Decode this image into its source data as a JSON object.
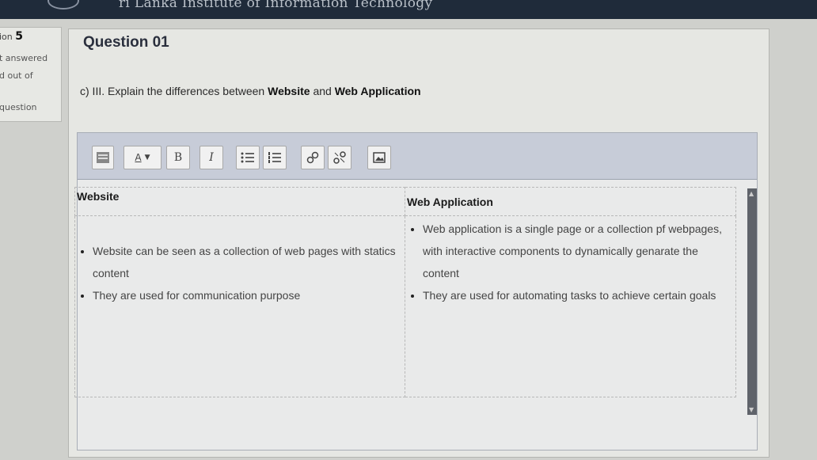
{
  "header": {
    "site_title": "ri Lanka Institute of Information Technology"
  },
  "question_info": {
    "label": "ion",
    "number": "5",
    "status": "t answered",
    "marks": "d out of",
    "flag": "question"
  },
  "question": {
    "title": "Question 01",
    "prefix": "c) III. Explain the differences between",
    "term1": "Website",
    "conjunction": "and",
    "term2": "Web Application"
  },
  "toolbar": {
    "buttons": [
      "toolbar-toggle",
      "font-color",
      "bold",
      "italic",
      "bullet-list",
      "numbered-list",
      "link",
      "unlink",
      "image"
    ],
    "bold_label": "B",
    "italic_label": "I",
    "font_label": "A"
  },
  "answer_table": {
    "headers": [
      "Website",
      "Web Application"
    ],
    "website_points": [
      "Website can be seen as a collection of web pages with statics content",
      "They are used for communication purpose"
    ],
    "webapp_points": [
      "Web application is a single page or a collection pf webpages, with interactive components to dynamically genarate the content",
      "They are used for automating tasks to achieve certain goals"
    ]
  }
}
